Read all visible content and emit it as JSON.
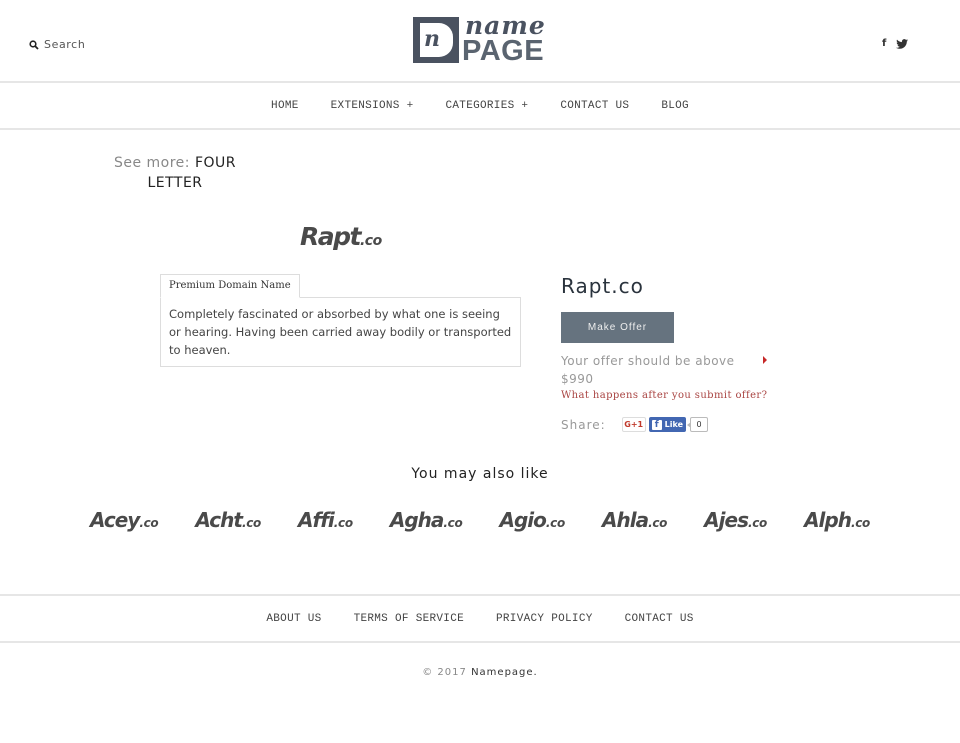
{
  "header": {
    "search_label": "Search",
    "logo": {
      "name": "name",
      "page": "PAGE",
      "mark_letter": "n"
    },
    "social": {
      "facebook": "f"
    }
  },
  "nav": {
    "items": [
      {
        "label": "HOME"
      },
      {
        "label": "EXTENSIONS +"
      },
      {
        "label": "CATEGORIES +"
      },
      {
        "label": "CONTACT US"
      },
      {
        "label": "BLOG"
      }
    ]
  },
  "see_more": {
    "label": "See more:",
    "link": "FOUR LETTER"
  },
  "domain": {
    "logo_name": "Rapt",
    "logo_ext": ".co",
    "title": "Rapt.co",
    "tab_label": "Premium Domain Name",
    "description": "Completely fascinated or absorbed by what one is seeing or hearing. Having been carried away bodily or transported to heaven."
  },
  "offer": {
    "button": "Make Offer",
    "note": "Your offer should be above $990",
    "what_happens": "What happens after you submit offer?",
    "share_label": "Share:",
    "gplus": "G+1",
    "fb_like": "Like",
    "fb_count": "0"
  },
  "also_like": {
    "title": "You may also like",
    "items": [
      {
        "name": "Acey",
        "ext": ".co"
      },
      {
        "name": "Acht",
        "ext": ".co"
      },
      {
        "name": "Affi",
        "ext": ".co"
      },
      {
        "name": "Agha",
        "ext": ".co"
      },
      {
        "name": "Agio",
        "ext": ".co"
      },
      {
        "name": "Ahla",
        "ext": ".co"
      },
      {
        "name": "Ajes",
        "ext": ".co"
      },
      {
        "name": "Alph",
        "ext": ".co"
      }
    ]
  },
  "footer": {
    "links": [
      {
        "label": "ABOUT US"
      },
      {
        "label": "TERMS OF SERVICE"
      },
      {
        "label": "PRIVACY POLICY"
      },
      {
        "label": "CONTACT US"
      }
    ],
    "copyright": "© 2017",
    "brand": "Namepage."
  },
  "colors": {
    "logo": "#4a5260",
    "button": "#66737f",
    "link_red": "#a94442",
    "facebook": "#4267b2"
  }
}
